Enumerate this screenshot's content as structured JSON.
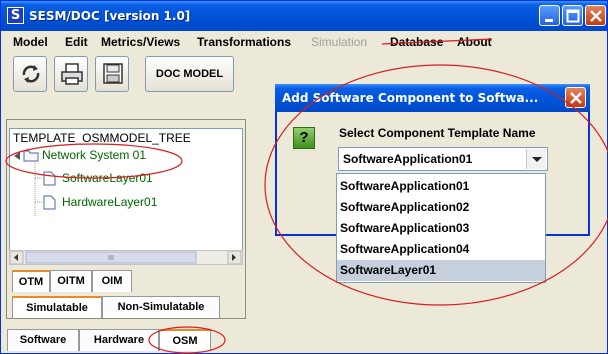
{
  "window": {
    "title": "SESM/DOC [version 1.0]",
    "logo_letter": "S"
  },
  "menu": {
    "items": [
      {
        "label": "Model",
        "enabled": true
      },
      {
        "label": "Edit",
        "enabled": true
      },
      {
        "label": "Metrics/Views",
        "enabled": true
      },
      {
        "label": "Transformations",
        "enabled": true
      },
      {
        "label": "Simulation",
        "enabled": false
      },
      {
        "label": "Database",
        "enabled": true
      },
      {
        "label": "About",
        "enabled": true
      }
    ]
  },
  "toolbar": {
    "buttons": [
      {
        "name": "refresh-icon"
      },
      {
        "name": "print-icon"
      },
      {
        "name": "save-icon"
      }
    ],
    "doc_model_label": "DOC MODEL"
  },
  "tree": {
    "root_label": "TEMPLATE_OSMMODEL_TREE",
    "nodes": [
      {
        "label": "Network System 01",
        "icon": "folder-icon"
      },
      {
        "label": "SoftwareLayer01",
        "icon": "document-icon"
      },
      {
        "label": "HardwareLayer01",
        "icon": "document-icon"
      }
    ]
  },
  "model_tabs": {
    "items": [
      {
        "label": "OTM",
        "active": true
      },
      {
        "label": "OITM",
        "active": false
      },
      {
        "label": "OIM",
        "active": false
      }
    ]
  },
  "sim_tabs": {
    "items": [
      {
        "label": "Simulatable",
        "active": true
      },
      {
        "label": "Non-Simulatable",
        "active": false
      }
    ]
  },
  "bottom_tabs": {
    "items": [
      {
        "label": "Software",
        "active": false
      },
      {
        "label": "Hardware",
        "active": false
      },
      {
        "label": "OSM",
        "active": true
      }
    ]
  },
  "dialog": {
    "title": "Add Software Component to Softwa...",
    "prompt": "Select Component Template Name",
    "selected_value": "SoftwareApplication01",
    "options": [
      "SoftwareApplication01",
      "SoftwareApplication02",
      "SoftwareApplication03",
      "SoftwareApplication04",
      "SoftwareLayer01"
    ],
    "highlighted_option": "SoftwareLayer01"
  },
  "colors": {
    "titlebar": "#0052d6",
    "tree_node_text": "#006600",
    "annotation_ring": "#d81e1e",
    "active_tab_accent": "#e68b2c"
  }
}
